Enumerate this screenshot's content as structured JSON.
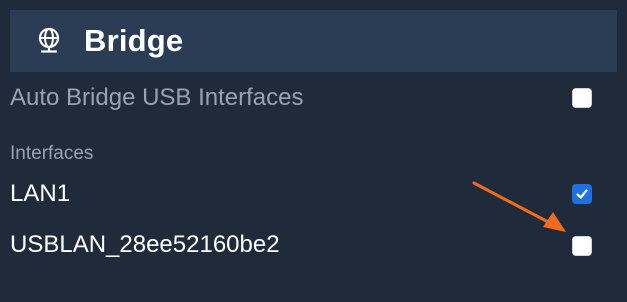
{
  "header": {
    "title": "Bridge",
    "icon": "network-globe-icon"
  },
  "auto_bridge": {
    "label": "Auto Bridge USB Interfaces",
    "checked": false
  },
  "interfaces": {
    "section_label": "Interfaces",
    "items": [
      {
        "label": "LAN1",
        "checked": true
      },
      {
        "label": "USBLAN_28ee52160be2",
        "checked": false
      }
    ]
  },
  "colors": {
    "panel_bg": "#1f2a3a",
    "header_bg": "#2b3d55",
    "checkbox_checked": "#1f6fe5",
    "annotation_arrow": "#f26b1d"
  }
}
